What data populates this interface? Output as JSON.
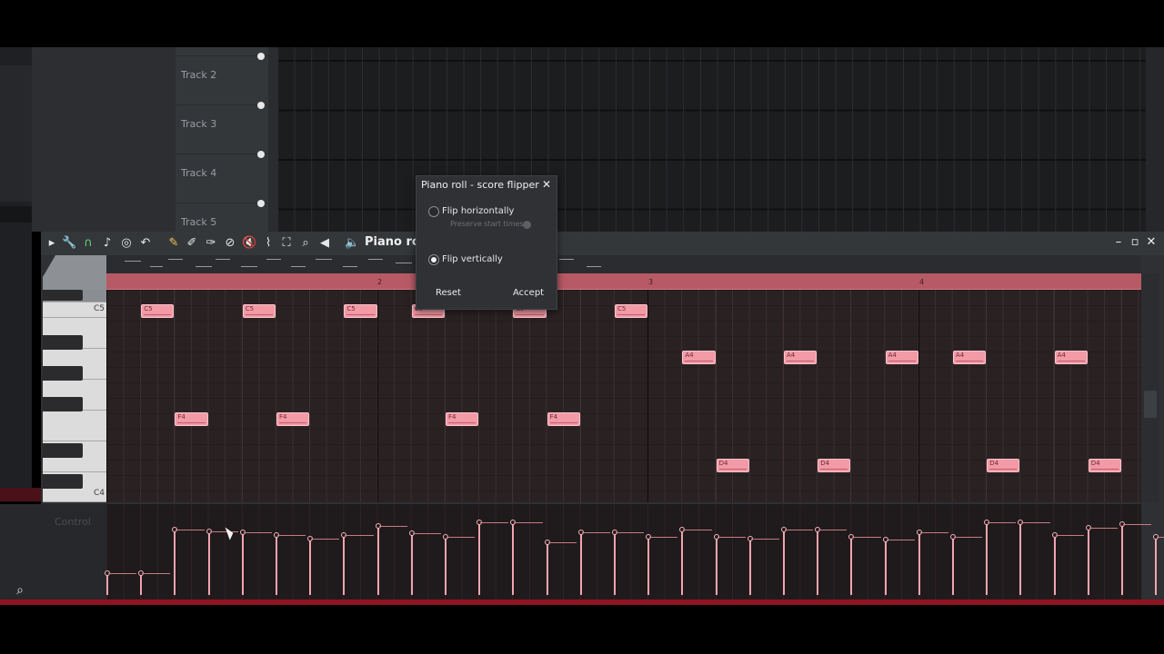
{
  "playlist": {
    "tracks": [
      {
        "name": "Track 2"
      },
      {
        "name": "Track 3"
      },
      {
        "name": "Track 4"
      },
      {
        "name": "Track 5"
      }
    ]
  },
  "piano_roll": {
    "title": "Piano roll",
    "bar_numbers": [
      "2",
      "3",
      "4"
    ],
    "keys": {
      "top": "C5",
      "bottom": "C4"
    },
    "notes": [
      {
        "label": "C5",
        "pitch": 72,
        "start": 2,
        "len": 2
      },
      {
        "label": "C5",
        "pitch": 72,
        "start": 8,
        "len": 2
      },
      {
        "label": "C5",
        "pitch": 72,
        "start": 14,
        "len": 2
      },
      {
        "label": "C5",
        "pitch": 72,
        "start": 18,
        "len": 2
      },
      {
        "label": "C5",
        "pitch": 72,
        "start": 24,
        "len": 2
      },
      {
        "label": "C5",
        "pitch": 72,
        "start": 30,
        "len": 2
      },
      {
        "label": "A4",
        "pitch": 69,
        "start": 34,
        "len": 2
      },
      {
        "label": "A4",
        "pitch": 69,
        "start": 40,
        "len": 2
      },
      {
        "label": "A4",
        "pitch": 69,
        "start": 46,
        "len": 2
      },
      {
        "label": "A4",
        "pitch": 69,
        "start": 50,
        "len": 2
      },
      {
        "label": "A4",
        "pitch": 69,
        "start": 56,
        "len": 2
      },
      {
        "label": "F4",
        "pitch": 65,
        "start": 4,
        "len": 2
      },
      {
        "label": "F4",
        "pitch": 65,
        "start": 10,
        "len": 2
      },
      {
        "label": "F4",
        "pitch": 65,
        "start": 20,
        "len": 2
      },
      {
        "label": "F4",
        "pitch": 65,
        "start": 26,
        "len": 2
      },
      {
        "label": "D4",
        "pitch": 62,
        "start": 36,
        "len": 2
      },
      {
        "label": "D4",
        "pitch": 62,
        "start": 42,
        "len": 2
      },
      {
        "label": "D4",
        "pitch": 62,
        "start": 52,
        "len": 2
      },
      {
        "label": "D4",
        "pitch": 62,
        "start": 58,
        "len": 2
      }
    ],
    "event_editor": {
      "label": "Control",
      "values": [
        0.3,
        0.3,
        0.9,
        0.88,
        0.86,
        0.82,
        0.78,
        0.82,
        0.95,
        0.85,
        0.8,
        1.0,
        1.0,
        0.73,
        0.86,
        0.86,
        0.8,
        0.9,
        0.8,
        0.78,
        0.9,
        0.9,
        0.8,
        0.76,
        0.86,
        0.8,
        1.0,
        1.0,
        0.82,
        0.92,
        0.98,
        0.8
      ]
    }
  },
  "dialog": {
    "title": "Piano roll - score flipper",
    "close": "✕",
    "option1": "Flip horizontally",
    "option1_sub": "Preserve start times",
    "option2": "Flip vertically",
    "option1_checked": false,
    "option2_checked": true,
    "reset": "Reset",
    "accept": "Accept"
  },
  "colors": {
    "note": "#f29aa6",
    "ruler": "#b85a66",
    "accent_red": "#8e1422"
  }
}
